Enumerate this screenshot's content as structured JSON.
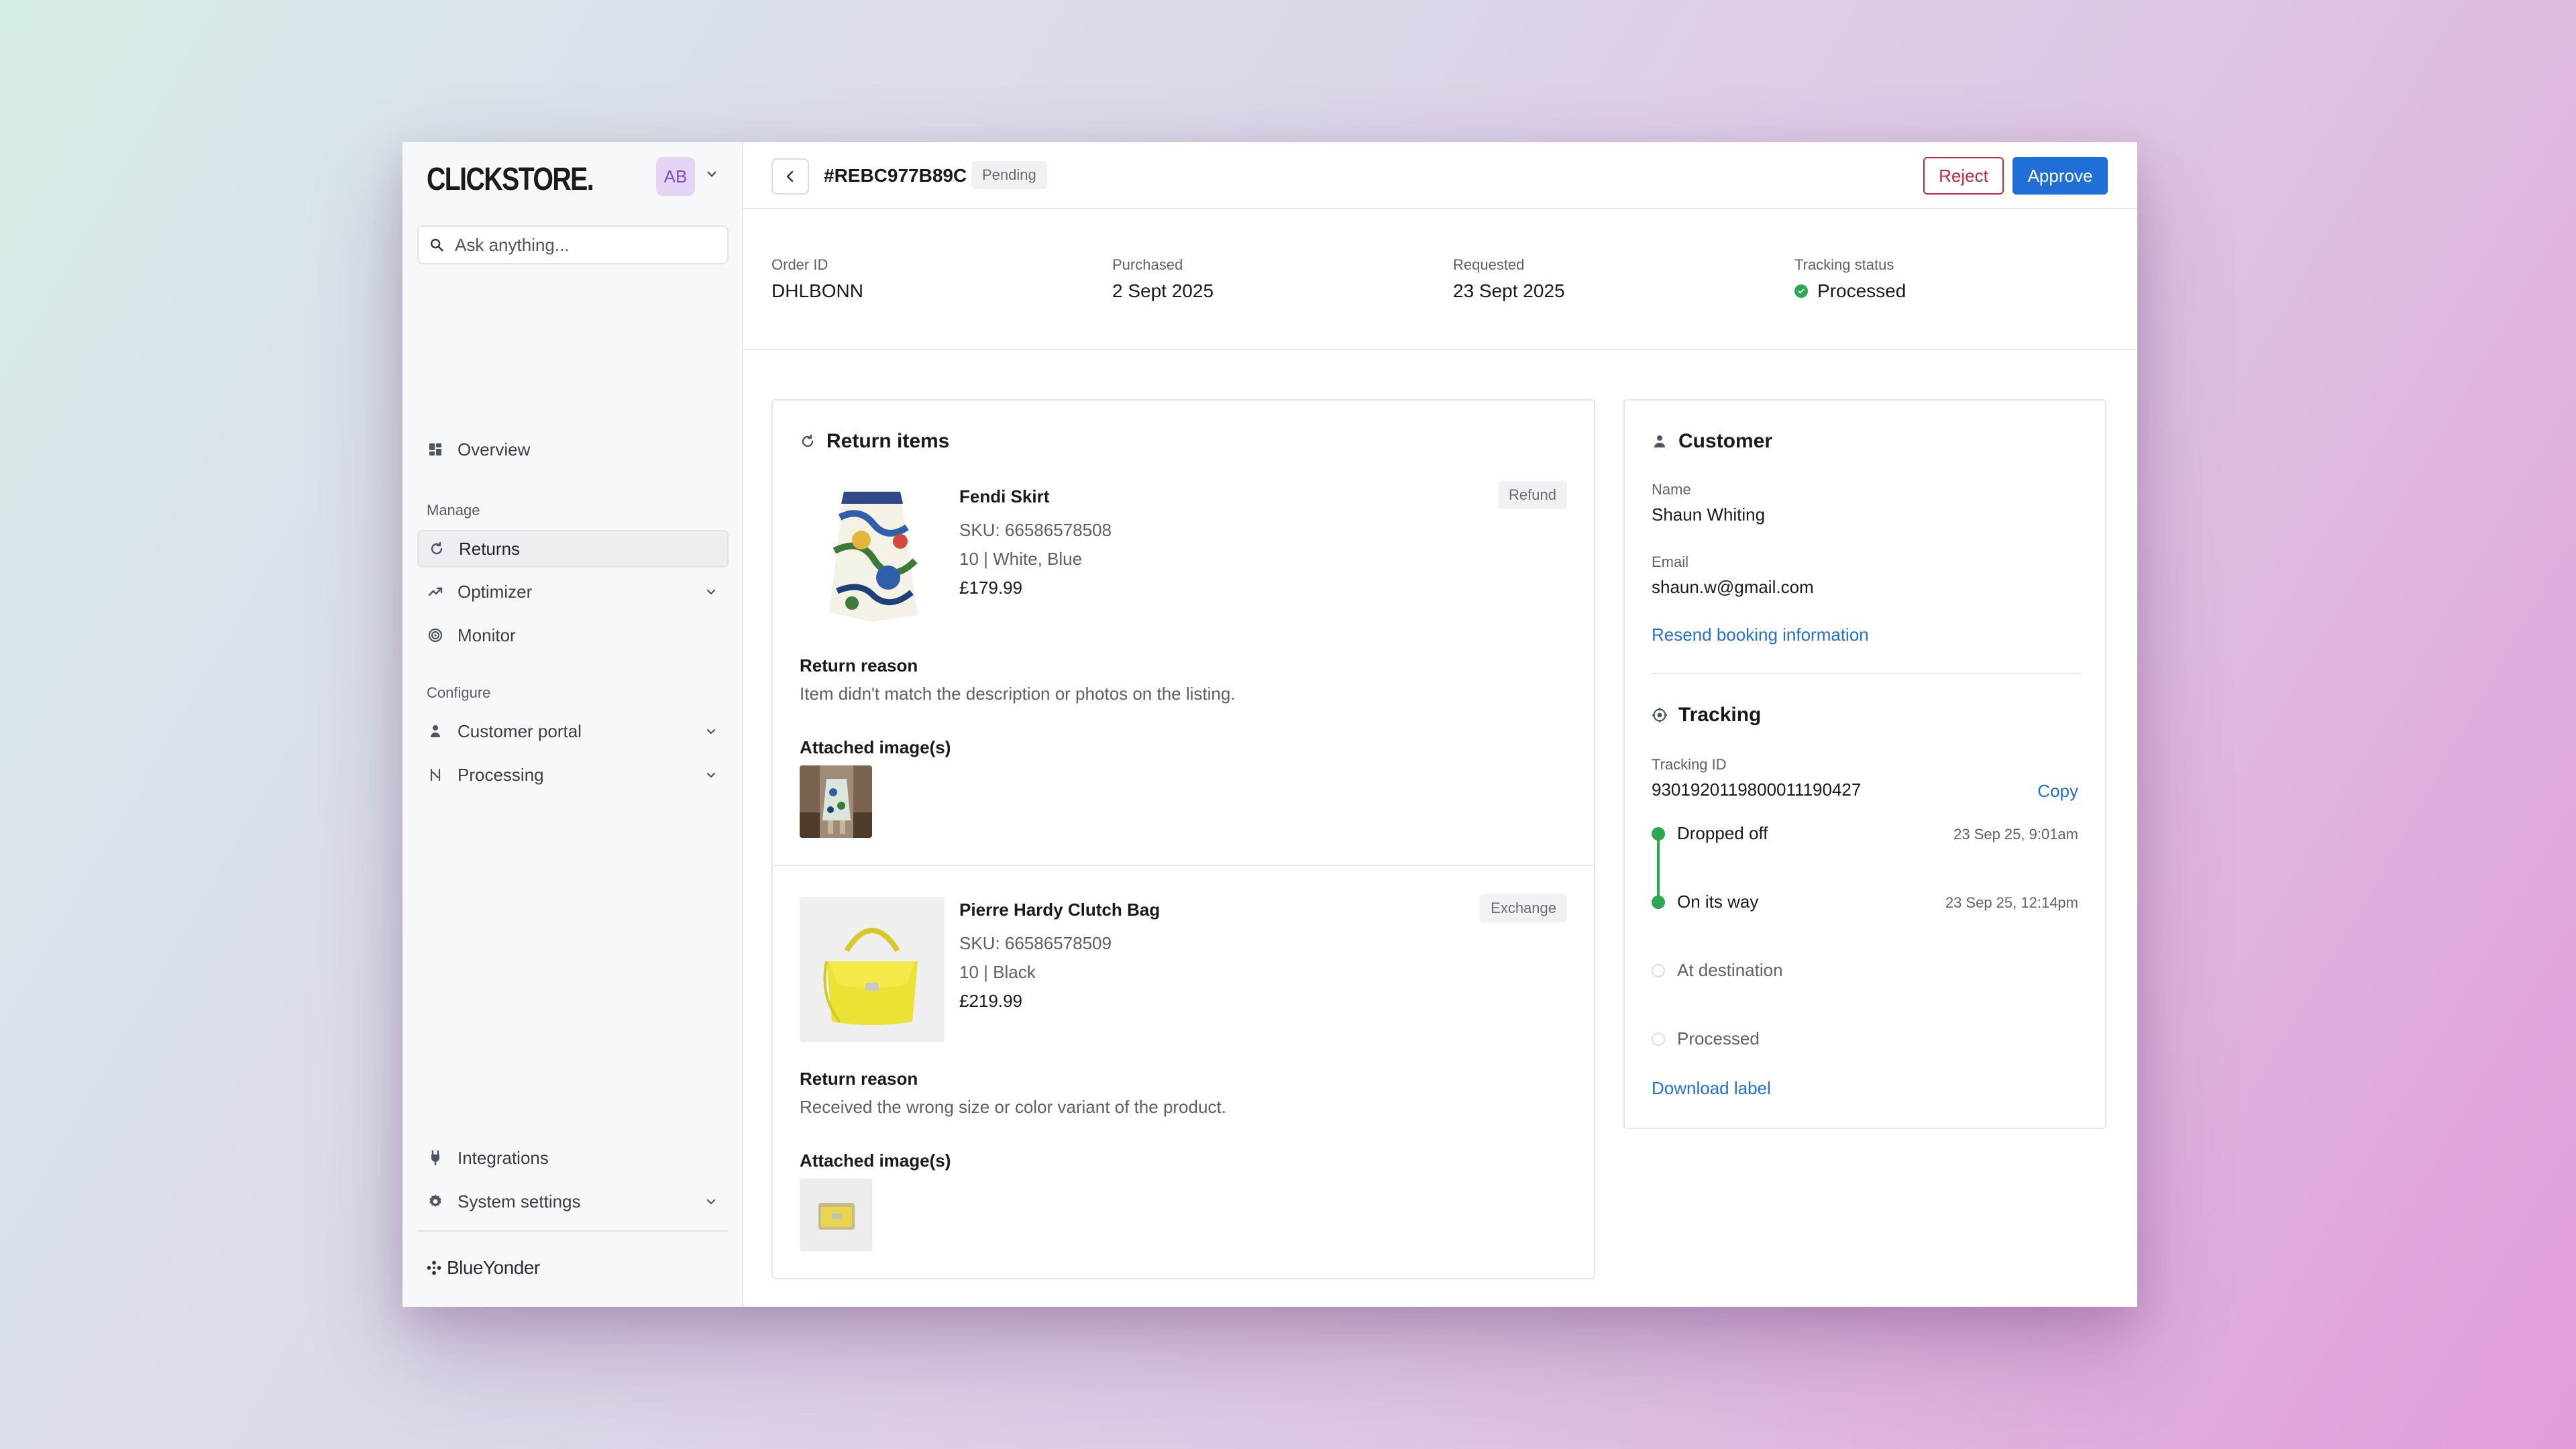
{
  "app": {
    "logo": "CLICKSTORE.",
    "avatar_initials": "AB",
    "brand_footer": "BlueYonder"
  },
  "search": {
    "placeholder": "Ask anything..."
  },
  "sidebar": {
    "overview": "Overview",
    "section_manage": "Manage",
    "returns": "Returns",
    "optimizer": "Optimizer",
    "monitor": "Monitor",
    "section_configure": "Configure",
    "customer_portal": "Customer portal",
    "processing": "Processing",
    "integrations": "Integrations",
    "system_settings": "System settings"
  },
  "header": {
    "return_id": "#REBC977B89C",
    "status_badge": "Pending",
    "reject_label": "Reject",
    "approve_label": "Approve"
  },
  "summary": {
    "order_id_label": "Order ID",
    "order_id": "DHLBONN",
    "purchased_label": "Purchased",
    "purchased": "2 Sept 2025",
    "requested_label": "Requested",
    "requested": "23 Sept 2025",
    "tracking_status_label": "Tracking status",
    "tracking_status": "Processed"
  },
  "return_items": {
    "title": "Return items",
    "reason_heading": "Return reason",
    "attached_heading": "Attached image(s)",
    "items": [
      {
        "name": "Fendi Skirt",
        "sku": "SKU: 66586578508",
        "variant": "10 | White, Blue",
        "price": "£179.99",
        "type": "Refund",
        "reason": "Item didn't match the description or photos on the listing."
      },
      {
        "name": "Pierre Hardy Clutch Bag",
        "sku": "SKU: 66586578509",
        "variant": "10 | Black",
        "price": "£219.99",
        "type": "Exchange",
        "reason": "Received the wrong size or color variant of the product."
      }
    ]
  },
  "customer": {
    "title": "Customer",
    "name_label": "Name",
    "name": "Shaun Whiting",
    "email_label": "Email",
    "email": "shaun.w@gmail.com",
    "resend_link": "Resend booking information"
  },
  "tracking": {
    "title": "Tracking",
    "id_label": "Tracking ID",
    "id": "9301920119800011190427",
    "copy_label": "Copy",
    "steps": [
      {
        "label": "Dropped off",
        "time": "23 Sep 25, 9:01am",
        "done": true
      },
      {
        "label": "On its way",
        "time": "23 Sep 25, 12:14pm",
        "done": true
      },
      {
        "label": "At destination",
        "time": "",
        "done": false
      },
      {
        "label": "Processed",
        "time": "",
        "done": false
      }
    ],
    "download_label": "Download label"
  },
  "colors": {
    "accent_blue": "#1f6fd6",
    "reject_red": "#c6283b",
    "success_green": "#2aa852",
    "avatar_bg": "#e6d4f7"
  }
}
